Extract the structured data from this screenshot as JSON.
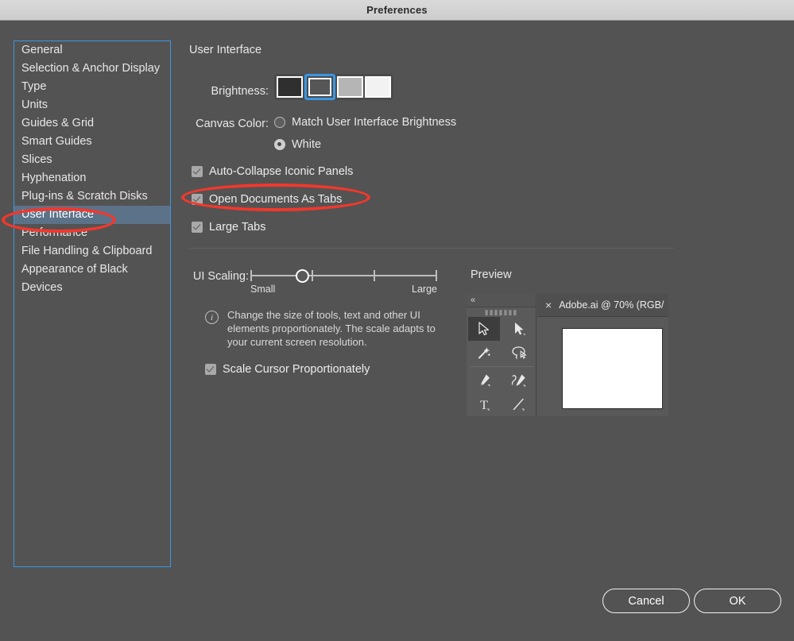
{
  "window": {
    "title": "Preferences"
  },
  "sidebar": {
    "items": [
      {
        "label": "General",
        "selected": false
      },
      {
        "label": "Selection & Anchor Display",
        "selected": false
      },
      {
        "label": "Type",
        "selected": false
      },
      {
        "label": "Units",
        "selected": false
      },
      {
        "label": "Guides & Grid",
        "selected": false
      },
      {
        "label": "Smart Guides",
        "selected": false
      },
      {
        "label": "Slices",
        "selected": false
      },
      {
        "label": "Hyphenation",
        "selected": false
      },
      {
        "label": "Plug-ins & Scratch Disks",
        "selected": false
      },
      {
        "label": "User Interface",
        "selected": true
      },
      {
        "label": "Performance",
        "selected": false
      },
      {
        "label": "File Handling & Clipboard",
        "selected": false
      },
      {
        "label": "Appearance of Black",
        "selected": false
      },
      {
        "label": "Devices",
        "selected": false
      }
    ]
  },
  "panel": {
    "title": "User Interface",
    "brightness": {
      "label": "Brightness:",
      "selected_index": 1,
      "swatches": [
        {
          "name": "darkest",
          "color": "#2f2f2f"
        },
        {
          "name": "dark",
          "color": "#565656"
        },
        {
          "name": "light",
          "color": "#b5b5b5"
        },
        {
          "name": "lightest",
          "color": "#f2f2f2"
        }
      ]
    },
    "canvas_color": {
      "label": "Canvas Color:",
      "options": [
        {
          "label": "Match User Interface Brightness",
          "selected": false
        },
        {
          "label": "White",
          "selected": true
        }
      ]
    },
    "checkboxes": [
      {
        "label": "Auto-Collapse Iconic Panels",
        "checked": true
      },
      {
        "label": "Open Documents As Tabs",
        "checked": true
      },
      {
        "label": "Large Tabs",
        "checked": true
      }
    ],
    "ui_scaling": {
      "label": "UI Scaling:",
      "min_label": "Small",
      "max_label": "Large",
      "tick_count": 4,
      "handle_position_percent": 27,
      "info_icon": "info-icon",
      "info_text": "Change the size of tools, text and other UI elements proportionately. The scale adapts to your current screen resolution.",
      "scale_cursor": {
        "label": "Scale Cursor Proportionately",
        "checked": true
      }
    },
    "preview": {
      "title": "Preview",
      "toolpanel": {
        "collapse_glyph": "«",
        "tools": [
          {
            "name": "selection-tool",
            "active": true
          },
          {
            "name": "direct-selection-tool",
            "active": false
          },
          {
            "name": "magic-wand-tool",
            "active": false
          },
          {
            "name": "lasso-tool",
            "active": false
          },
          {
            "name": "pen-tool",
            "active": false
          },
          {
            "name": "curvature-pen-tool",
            "active": false
          },
          {
            "name": "type-tool",
            "active": false
          },
          {
            "name": "line-segment-tool",
            "active": false
          }
        ]
      },
      "document_tab": {
        "close_glyph": "×",
        "label": "Adobe.ai @ 70% (RGB/"
      }
    }
  },
  "footer": {
    "cancel_label": "Cancel",
    "ok_label": "OK"
  },
  "annotations": {
    "accent_color": "#f4372c",
    "ellipses": [
      {
        "name": "sidebar-user-interface-highlight"
      },
      {
        "name": "open-documents-as-tabs-highlight"
      }
    ]
  },
  "colors": {
    "dialog_background": "#535353",
    "titlebar_background": "#d3d3d3",
    "focus_border": "#3b97e3",
    "selection_background": "#5b7289",
    "annotation_red": "#f4372c"
  }
}
